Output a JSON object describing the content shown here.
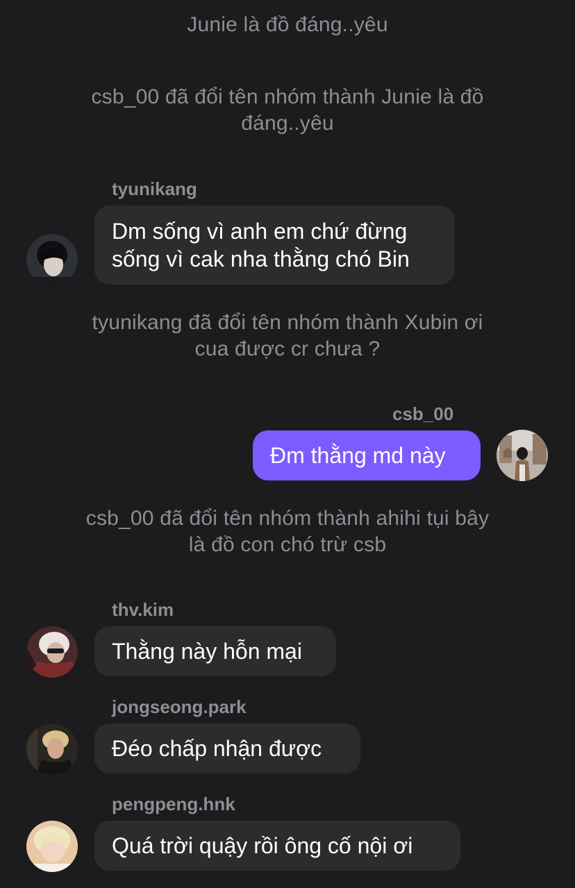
{
  "messages": [
    {
      "type": "system",
      "text": "Junie là đồ đáng..yêu"
    },
    {
      "type": "system",
      "text": "csb_00 đã đổi tên nhóm thành Junie là đồ đáng..yêu"
    },
    {
      "type": "incoming",
      "sender": "tyunikang",
      "text": "Dm sống vì anh em chứ đừng sống vì cak nha thằng chó Bin",
      "avatar": "avatar-photo"
    },
    {
      "type": "system",
      "text": "tyunikang đã đổi tên nhóm thành Xubin ơi cua được cr chưa ?"
    },
    {
      "type": "outgoing",
      "sender": "csb_00",
      "text": "Đm thằng md này",
      "avatar": "avatar-photo"
    },
    {
      "type": "system",
      "text": "csb_00 đã đổi tên nhóm thành ahihi tụi bây là đồ con chó trừ csb"
    },
    {
      "type": "incoming",
      "sender": "thv.kim",
      "text": "Thằng này hỗn mại",
      "avatar": "avatar-photo"
    },
    {
      "type": "incoming",
      "sender": "jongseong.park",
      "text": "Đéo chấp nhận được",
      "avatar": "avatar-photo"
    },
    {
      "type": "incoming",
      "sender": "pengpeng.hnk",
      "text": "Quá trời quậy rồi ông cố nội ơi",
      "avatar": "avatar-photo"
    }
  ],
  "colors": {
    "background": "#1c1c1e",
    "incoming_bubble": "#2c2c2e",
    "outgoing_bubble": "#7b5cff",
    "meta_text": "#8e8e93"
  }
}
